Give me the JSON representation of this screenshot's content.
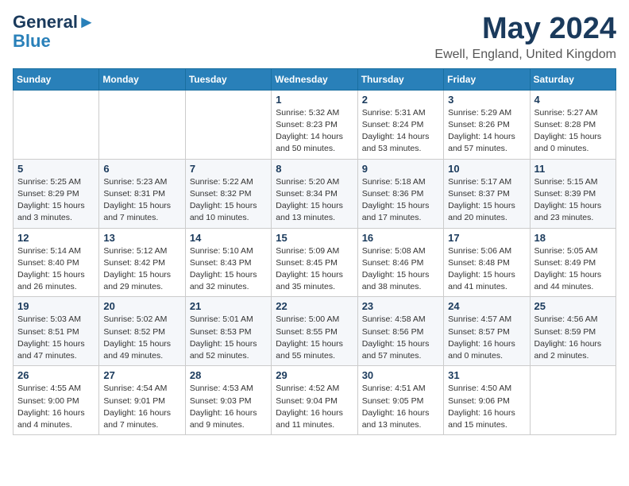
{
  "logo": {
    "line1": "General",
    "line2": "Blue"
  },
  "title": "May 2024",
  "location": "Ewell, England, United Kingdom",
  "weekdays": [
    "Sunday",
    "Monday",
    "Tuesday",
    "Wednesday",
    "Thursday",
    "Friday",
    "Saturday"
  ],
  "weeks": [
    [
      {
        "day": "",
        "info": ""
      },
      {
        "day": "",
        "info": ""
      },
      {
        "day": "",
        "info": ""
      },
      {
        "day": "1",
        "info": "Sunrise: 5:32 AM\nSunset: 8:23 PM\nDaylight: 14 hours\nand 50 minutes."
      },
      {
        "day": "2",
        "info": "Sunrise: 5:31 AM\nSunset: 8:24 PM\nDaylight: 14 hours\nand 53 minutes."
      },
      {
        "day": "3",
        "info": "Sunrise: 5:29 AM\nSunset: 8:26 PM\nDaylight: 14 hours\nand 57 minutes."
      },
      {
        "day": "4",
        "info": "Sunrise: 5:27 AM\nSunset: 8:28 PM\nDaylight: 15 hours\nand 0 minutes."
      }
    ],
    [
      {
        "day": "5",
        "info": "Sunrise: 5:25 AM\nSunset: 8:29 PM\nDaylight: 15 hours\nand 3 minutes."
      },
      {
        "day": "6",
        "info": "Sunrise: 5:23 AM\nSunset: 8:31 PM\nDaylight: 15 hours\nand 7 minutes."
      },
      {
        "day": "7",
        "info": "Sunrise: 5:22 AM\nSunset: 8:32 PM\nDaylight: 15 hours\nand 10 minutes."
      },
      {
        "day": "8",
        "info": "Sunrise: 5:20 AM\nSunset: 8:34 PM\nDaylight: 15 hours\nand 13 minutes."
      },
      {
        "day": "9",
        "info": "Sunrise: 5:18 AM\nSunset: 8:36 PM\nDaylight: 15 hours\nand 17 minutes."
      },
      {
        "day": "10",
        "info": "Sunrise: 5:17 AM\nSunset: 8:37 PM\nDaylight: 15 hours\nand 20 minutes."
      },
      {
        "day": "11",
        "info": "Sunrise: 5:15 AM\nSunset: 8:39 PM\nDaylight: 15 hours\nand 23 minutes."
      }
    ],
    [
      {
        "day": "12",
        "info": "Sunrise: 5:14 AM\nSunset: 8:40 PM\nDaylight: 15 hours\nand 26 minutes."
      },
      {
        "day": "13",
        "info": "Sunrise: 5:12 AM\nSunset: 8:42 PM\nDaylight: 15 hours\nand 29 minutes."
      },
      {
        "day": "14",
        "info": "Sunrise: 5:10 AM\nSunset: 8:43 PM\nDaylight: 15 hours\nand 32 minutes."
      },
      {
        "day": "15",
        "info": "Sunrise: 5:09 AM\nSunset: 8:45 PM\nDaylight: 15 hours\nand 35 minutes."
      },
      {
        "day": "16",
        "info": "Sunrise: 5:08 AM\nSunset: 8:46 PM\nDaylight: 15 hours\nand 38 minutes."
      },
      {
        "day": "17",
        "info": "Sunrise: 5:06 AM\nSunset: 8:48 PM\nDaylight: 15 hours\nand 41 minutes."
      },
      {
        "day": "18",
        "info": "Sunrise: 5:05 AM\nSunset: 8:49 PM\nDaylight: 15 hours\nand 44 minutes."
      }
    ],
    [
      {
        "day": "19",
        "info": "Sunrise: 5:03 AM\nSunset: 8:51 PM\nDaylight: 15 hours\nand 47 minutes."
      },
      {
        "day": "20",
        "info": "Sunrise: 5:02 AM\nSunset: 8:52 PM\nDaylight: 15 hours\nand 49 minutes."
      },
      {
        "day": "21",
        "info": "Sunrise: 5:01 AM\nSunset: 8:53 PM\nDaylight: 15 hours\nand 52 minutes."
      },
      {
        "day": "22",
        "info": "Sunrise: 5:00 AM\nSunset: 8:55 PM\nDaylight: 15 hours\nand 55 minutes."
      },
      {
        "day": "23",
        "info": "Sunrise: 4:58 AM\nSunset: 8:56 PM\nDaylight: 15 hours\nand 57 minutes."
      },
      {
        "day": "24",
        "info": "Sunrise: 4:57 AM\nSunset: 8:57 PM\nDaylight: 16 hours\nand 0 minutes."
      },
      {
        "day": "25",
        "info": "Sunrise: 4:56 AM\nSunset: 8:59 PM\nDaylight: 16 hours\nand 2 minutes."
      }
    ],
    [
      {
        "day": "26",
        "info": "Sunrise: 4:55 AM\nSunset: 9:00 PM\nDaylight: 16 hours\nand 4 minutes."
      },
      {
        "day": "27",
        "info": "Sunrise: 4:54 AM\nSunset: 9:01 PM\nDaylight: 16 hours\nand 7 minutes."
      },
      {
        "day": "28",
        "info": "Sunrise: 4:53 AM\nSunset: 9:03 PM\nDaylight: 16 hours\nand 9 minutes."
      },
      {
        "day": "29",
        "info": "Sunrise: 4:52 AM\nSunset: 9:04 PM\nDaylight: 16 hours\nand 11 minutes."
      },
      {
        "day": "30",
        "info": "Sunrise: 4:51 AM\nSunset: 9:05 PM\nDaylight: 16 hours\nand 13 minutes."
      },
      {
        "day": "31",
        "info": "Sunrise: 4:50 AM\nSunset: 9:06 PM\nDaylight: 16 hours\nand 15 minutes."
      },
      {
        "day": "",
        "info": ""
      }
    ]
  ]
}
